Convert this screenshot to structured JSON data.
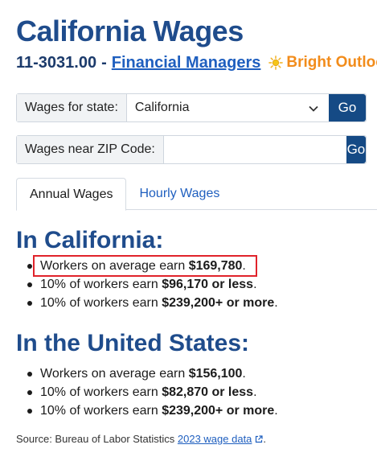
{
  "page": {
    "title": "California Wages",
    "occupation_code": "11-3031.00",
    "separator": "-",
    "occupation_title": "Financial Managers",
    "outlook_label": "Bright Outlook"
  },
  "state_selector": {
    "label": "Wages for state:",
    "selected": "California",
    "go_label": "Go"
  },
  "zip_search": {
    "label": "Wages near ZIP Code:",
    "value": "",
    "placeholder": "",
    "go_label": "Go"
  },
  "tabs": [
    {
      "label": "Annual Wages",
      "active": true
    },
    {
      "label": "Hourly Wages",
      "active": false
    }
  ],
  "california": {
    "heading": "In California:",
    "items": [
      {
        "prefix": "Workers on average earn ",
        "value": "$169,780",
        "suffix": "."
      },
      {
        "prefix": "10% of workers earn ",
        "value": "$96,170 or less",
        "suffix": "."
      },
      {
        "prefix": "10% of workers earn ",
        "value": "$239,200+ or more",
        "suffix": "."
      }
    ]
  },
  "united_states": {
    "heading": "In the United States:",
    "items": [
      {
        "prefix": "Workers on average earn ",
        "value": "$156,100",
        "suffix": "."
      },
      {
        "prefix": "10% of workers earn ",
        "value": "$82,870 or less",
        "suffix": "."
      },
      {
        "prefix": "10% of workers earn ",
        "value": "$239,200+ or more",
        "suffix": "."
      }
    ]
  },
  "source": {
    "prefix": "Source: Bureau of Labor Statistics ",
    "link_text": "2023 wage data",
    "suffix": "."
  },
  "colors": {
    "heading": "#1f4c8c",
    "link": "#1f5fbf",
    "go_button": "#154a85",
    "outlook": "#f28c1b",
    "highlight_box": "#e0232b"
  },
  "icons": {
    "outlook": "sun-icon",
    "state_dropdown": "chevron-down-icon",
    "source_link": "external-link-icon"
  }
}
